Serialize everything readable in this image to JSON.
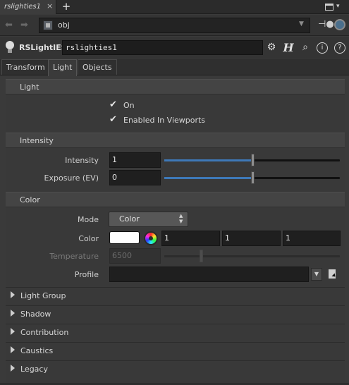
{
  "tabbar": {
    "tab_label": "rslighties1",
    "close_glyph": "×",
    "add_glyph": "+"
  },
  "pathbar": {
    "path_value": "obj"
  },
  "node": {
    "type_label": "RSLightIES",
    "name_value": "rslighties1"
  },
  "param_tabs": [
    "Transform",
    "Light",
    "Objects"
  ],
  "sections": {
    "light": {
      "title": "Light",
      "on_label": "On",
      "viewports_label": "Enabled In Viewports"
    },
    "intensity": {
      "title": "Intensity",
      "intensity_label": "Intensity",
      "intensity_value": "1",
      "intensity_slider_fraction": 0.5,
      "exposure_label": "Exposure (EV)",
      "exposure_value": "0",
      "exposure_slider_fraction": 0.5
    },
    "color": {
      "title": "Color",
      "mode_label": "Mode",
      "mode_value": "Color",
      "color_label": "Color",
      "color_r": "1",
      "color_g": "1",
      "color_b": "1",
      "swatch_color": "#ffffff",
      "temperature_label": "Temperature",
      "temperature_value": "6500",
      "temperature_slider_fraction": 0.21,
      "profile_label": "Profile",
      "profile_value": ""
    }
  },
  "collapsed_sections": [
    "Light Group",
    "Shadow",
    "Contribution",
    "Caustics",
    "Legacy"
  ],
  "colors": {
    "slider_fill": "#3e79b8",
    "panel_bg": "#393939",
    "header_bg": "#444444"
  },
  "icons": [
    "back-arrow-icon",
    "forward-arrow-icon",
    "network-icon",
    "pin-icon",
    "target-icon",
    "light-bulb-icon",
    "gear-icon",
    "houdini-h-icon",
    "search-icon",
    "info-icon",
    "help-icon",
    "file-chooser-icon",
    "window-menu-icon"
  ]
}
